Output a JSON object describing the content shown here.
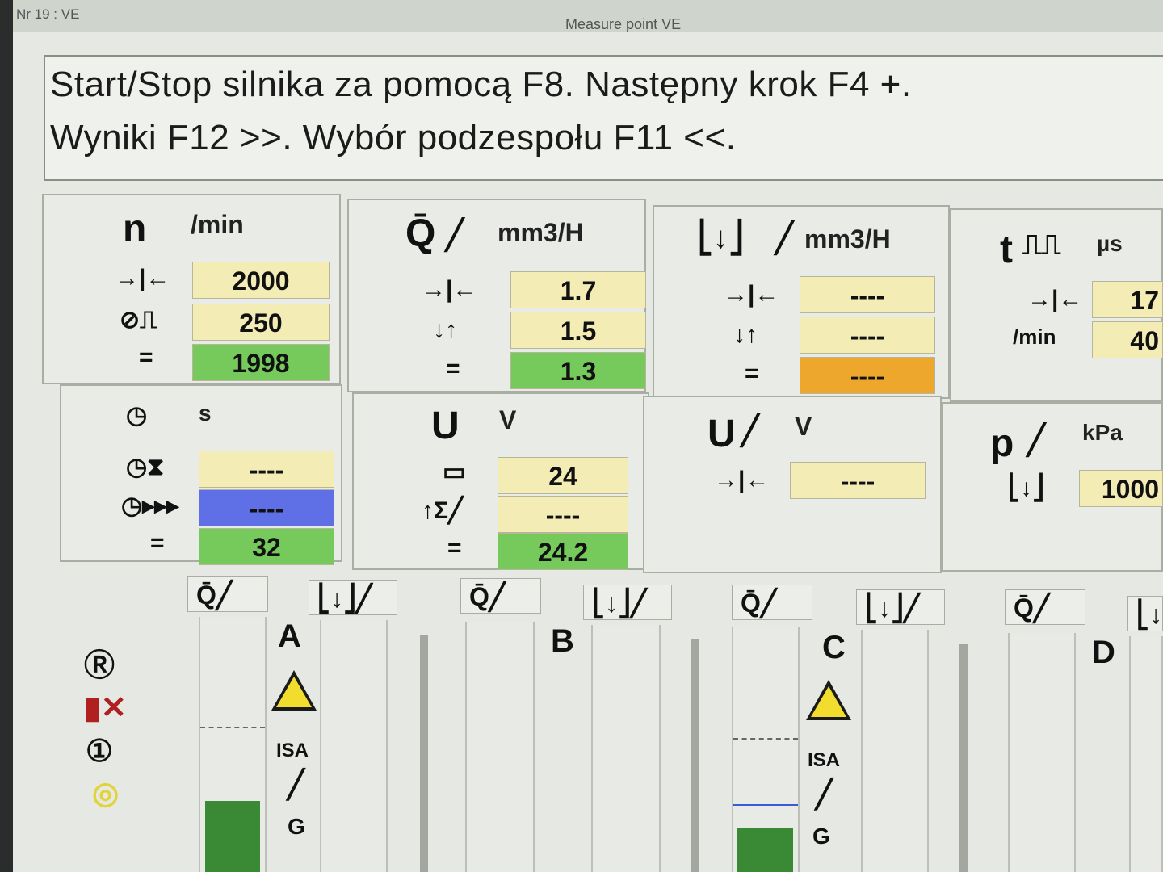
{
  "window": {
    "tag": "Nr 19 : VE",
    "title": "Measure point VE"
  },
  "message": {
    "line1": "Start/Stop silnika za pomocą F8. Następny krok F4 +.",
    "line2": "Wyniki F12 >>. Wybór podzespołu F11 <<."
  },
  "speed": {
    "symbol": "n",
    "unit": "/min",
    "setpoint": "2000",
    "tolerance": "250",
    "actual": "1998"
  },
  "time": {
    "unit": "s",
    "timer": "----",
    "fast": "----",
    "actual": "32"
  },
  "qmean": {
    "unit": "mm3/H",
    "setpoint": "1.7",
    "lower": "1.5",
    "actual": "1.3"
  },
  "voltage": {
    "symbol": "U",
    "unit": "V",
    "battery": "24",
    "sum": "----",
    "actual": "24.2"
  },
  "qreturn": {
    "unit": "mm3/H",
    "setpoint": "----",
    "lower": "----",
    "actual": "----"
  },
  "uinj": {
    "symbol": "U",
    "unit": "V",
    "setpoint": "----"
  },
  "pulse": {
    "symbol": "t",
    "unit": "µs",
    "setpoint": "17",
    "rate_unit": "/min",
    "rate": "40"
  },
  "pressure": {
    "symbol": "p",
    "unit": "kPa",
    "value": "1000"
  },
  "columns": [
    {
      "letter": "A",
      "isa": "ISA",
      "g": "G",
      "fill_percent": 28
    },
    {
      "letter": "B"
    },
    {
      "letter": "C",
      "isa": "ISA",
      "g": "G",
      "fill_percent": 18
    },
    {
      "letter": "D"
    }
  ],
  "icons": {
    "reset": "reset-icon",
    "disable": "injector-off-icon",
    "count": "counter-icon",
    "yellow": "yellow-status-icon"
  }
}
